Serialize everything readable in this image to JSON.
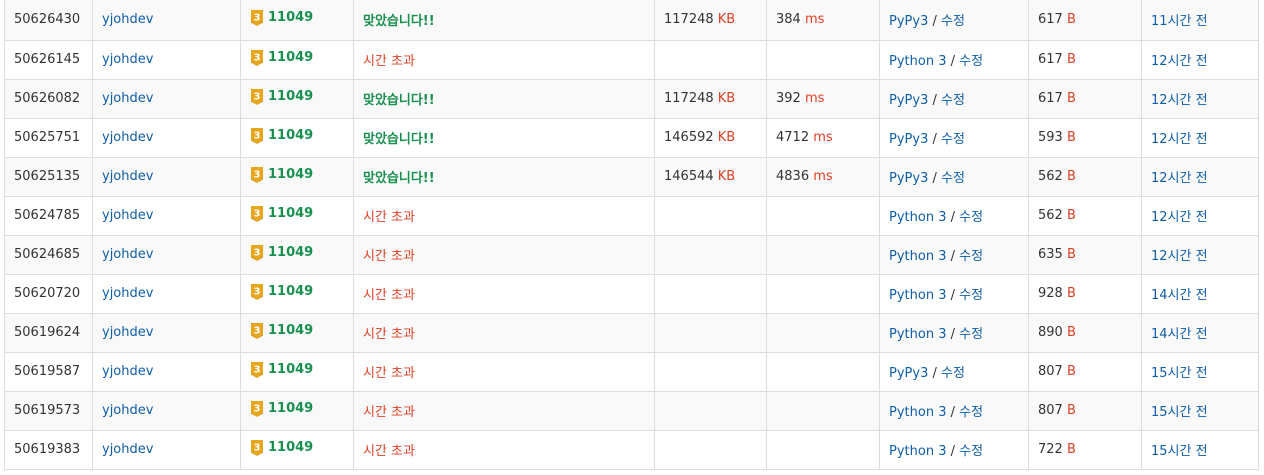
{
  "rows": [
    {
      "id": "50626430",
      "user": "yjohdev",
      "tier": "3",
      "problem": "11049",
      "result": "맞았습니다!!",
      "result_status": "ac",
      "memory": "117248",
      "memory_unit": "KB",
      "time": "384",
      "time_unit": "ms",
      "lang": "PyPy3",
      "edit": "수정",
      "code_len": "617",
      "code_unit": "B",
      "submitted": "11시간 전"
    },
    {
      "id": "50626145",
      "user": "yjohdev",
      "tier": "3",
      "problem": "11049",
      "result": "시간 초과",
      "result_status": "tle",
      "memory": "",
      "memory_unit": "",
      "time": "",
      "time_unit": "",
      "lang": "Python 3",
      "edit": "수정",
      "code_len": "617",
      "code_unit": "B",
      "submitted": "12시간 전"
    },
    {
      "id": "50626082",
      "user": "yjohdev",
      "tier": "3",
      "problem": "11049",
      "result": "맞았습니다!!",
      "result_status": "ac",
      "memory": "117248",
      "memory_unit": "KB",
      "time": "392",
      "time_unit": "ms",
      "lang": "PyPy3",
      "edit": "수정",
      "code_len": "617",
      "code_unit": "B",
      "submitted": "12시간 전"
    },
    {
      "id": "50625751",
      "user": "yjohdev",
      "tier": "3",
      "problem": "11049",
      "result": "맞았습니다!!",
      "result_status": "ac",
      "memory": "146592",
      "memory_unit": "KB",
      "time": "4712",
      "time_unit": "ms",
      "lang": "PyPy3",
      "edit": "수정",
      "code_len": "593",
      "code_unit": "B",
      "submitted": "12시간 전"
    },
    {
      "id": "50625135",
      "user": "yjohdev",
      "tier": "3",
      "problem": "11049",
      "result": "맞았습니다!!",
      "result_status": "ac",
      "memory": "146544",
      "memory_unit": "KB",
      "time": "4836",
      "time_unit": "ms",
      "lang": "PyPy3",
      "edit": "수정",
      "code_len": "562",
      "code_unit": "B",
      "submitted": "12시간 전"
    },
    {
      "id": "50624785",
      "user": "yjohdev",
      "tier": "3",
      "problem": "11049",
      "result": "시간 초과",
      "result_status": "tle",
      "memory": "",
      "memory_unit": "",
      "time": "",
      "time_unit": "",
      "lang": "Python 3",
      "edit": "수정",
      "code_len": "562",
      "code_unit": "B",
      "submitted": "12시간 전"
    },
    {
      "id": "50624685",
      "user": "yjohdev",
      "tier": "3",
      "problem": "11049",
      "result": "시간 초과",
      "result_status": "tle",
      "memory": "",
      "memory_unit": "",
      "time": "",
      "time_unit": "",
      "lang": "Python 3",
      "edit": "수정",
      "code_len": "635",
      "code_unit": "B",
      "submitted": "12시간 전"
    },
    {
      "id": "50620720",
      "user": "yjohdev",
      "tier": "3",
      "problem": "11049",
      "result": "시간 초과",
      "result_status": "tle",
      "memory": "",
      "memory_unit": "",
      "time": "",
      "time_unit": "",
      "lang": "Python 3",
      "edit": "수정",
      "code_len": "928",
      "code_unit": "B",
      "submitted": "14시간 전"
    },
    {
      "id": "50619624",
      "user": "yjohdev",
      "tier": "3",
      "problem": "11049",
      "result": "시간 초과",
      "result_status": "tle",
      "memory": "",
      "memory_unit": "",
      "time": "",
      "time_unit": "",
      "lang": "Python 3",
      "edit": "수정",
      "code_len": "890",
      "code_unit": "B",
      "submitted": "14시간 전"
    },
    {
      "id": "50619587",
      "user": "yjohdev",
      "tier": "3",
      "problem": "11049",
      "result": "시간 초과",
      "result_status": "tle",
      "memory": "",
      "memory_unit": "",
      "time": "",
      "time_unit": "",
      "lang": "PyPy3",
      "edit": "수정",
      "code_len": "807",
      "code_unit": "B",
      "submitted": "15시간 전"
    },
    {
      "id": "50619573",
      "user": "yjohdev",
      "tier": "3",
      "problem": "11049",
      "result": "시간 초과",
      "result_status": "tle",
      "memory": "",
      "memory_unit": "",
      "time": "",
      "time_unit": "",
      "lang": "Python 3",
      "edit": "수정",
      "code_len": "807",
      "code_unit": "B",
      "submitted": "15시간 전"
    },
    {
      "id": "50619383",
      "user": "yjohdev",
      "tier": "3",
      "problem": "11049",
      "result": "시간 초과",
      "result_status": "tle",
      "memory": "",
      "memory_unit": "",
      "time": "",
      "time_unit": "",
      "lang": "Python 3",
      "edit": "수정",
      "code_len": "722",
      "code_unit": "B",
      "submitted": "15시간 전"
    }
  ],
  "lang_separator": "/",
  "colors": {
    "accepted": "#18904f",
    "time_limit": "#dd4124",
    "link": "#0f5ea8",
    "unit": "#dd4124",
    "tier_badge": "#e7a61c",
    "row_alt": "#f9f9f9",
    "border": "#dddddd"
  },
  "icons": {
    "tier": "gold-tier-badge-icon"
  }
}
